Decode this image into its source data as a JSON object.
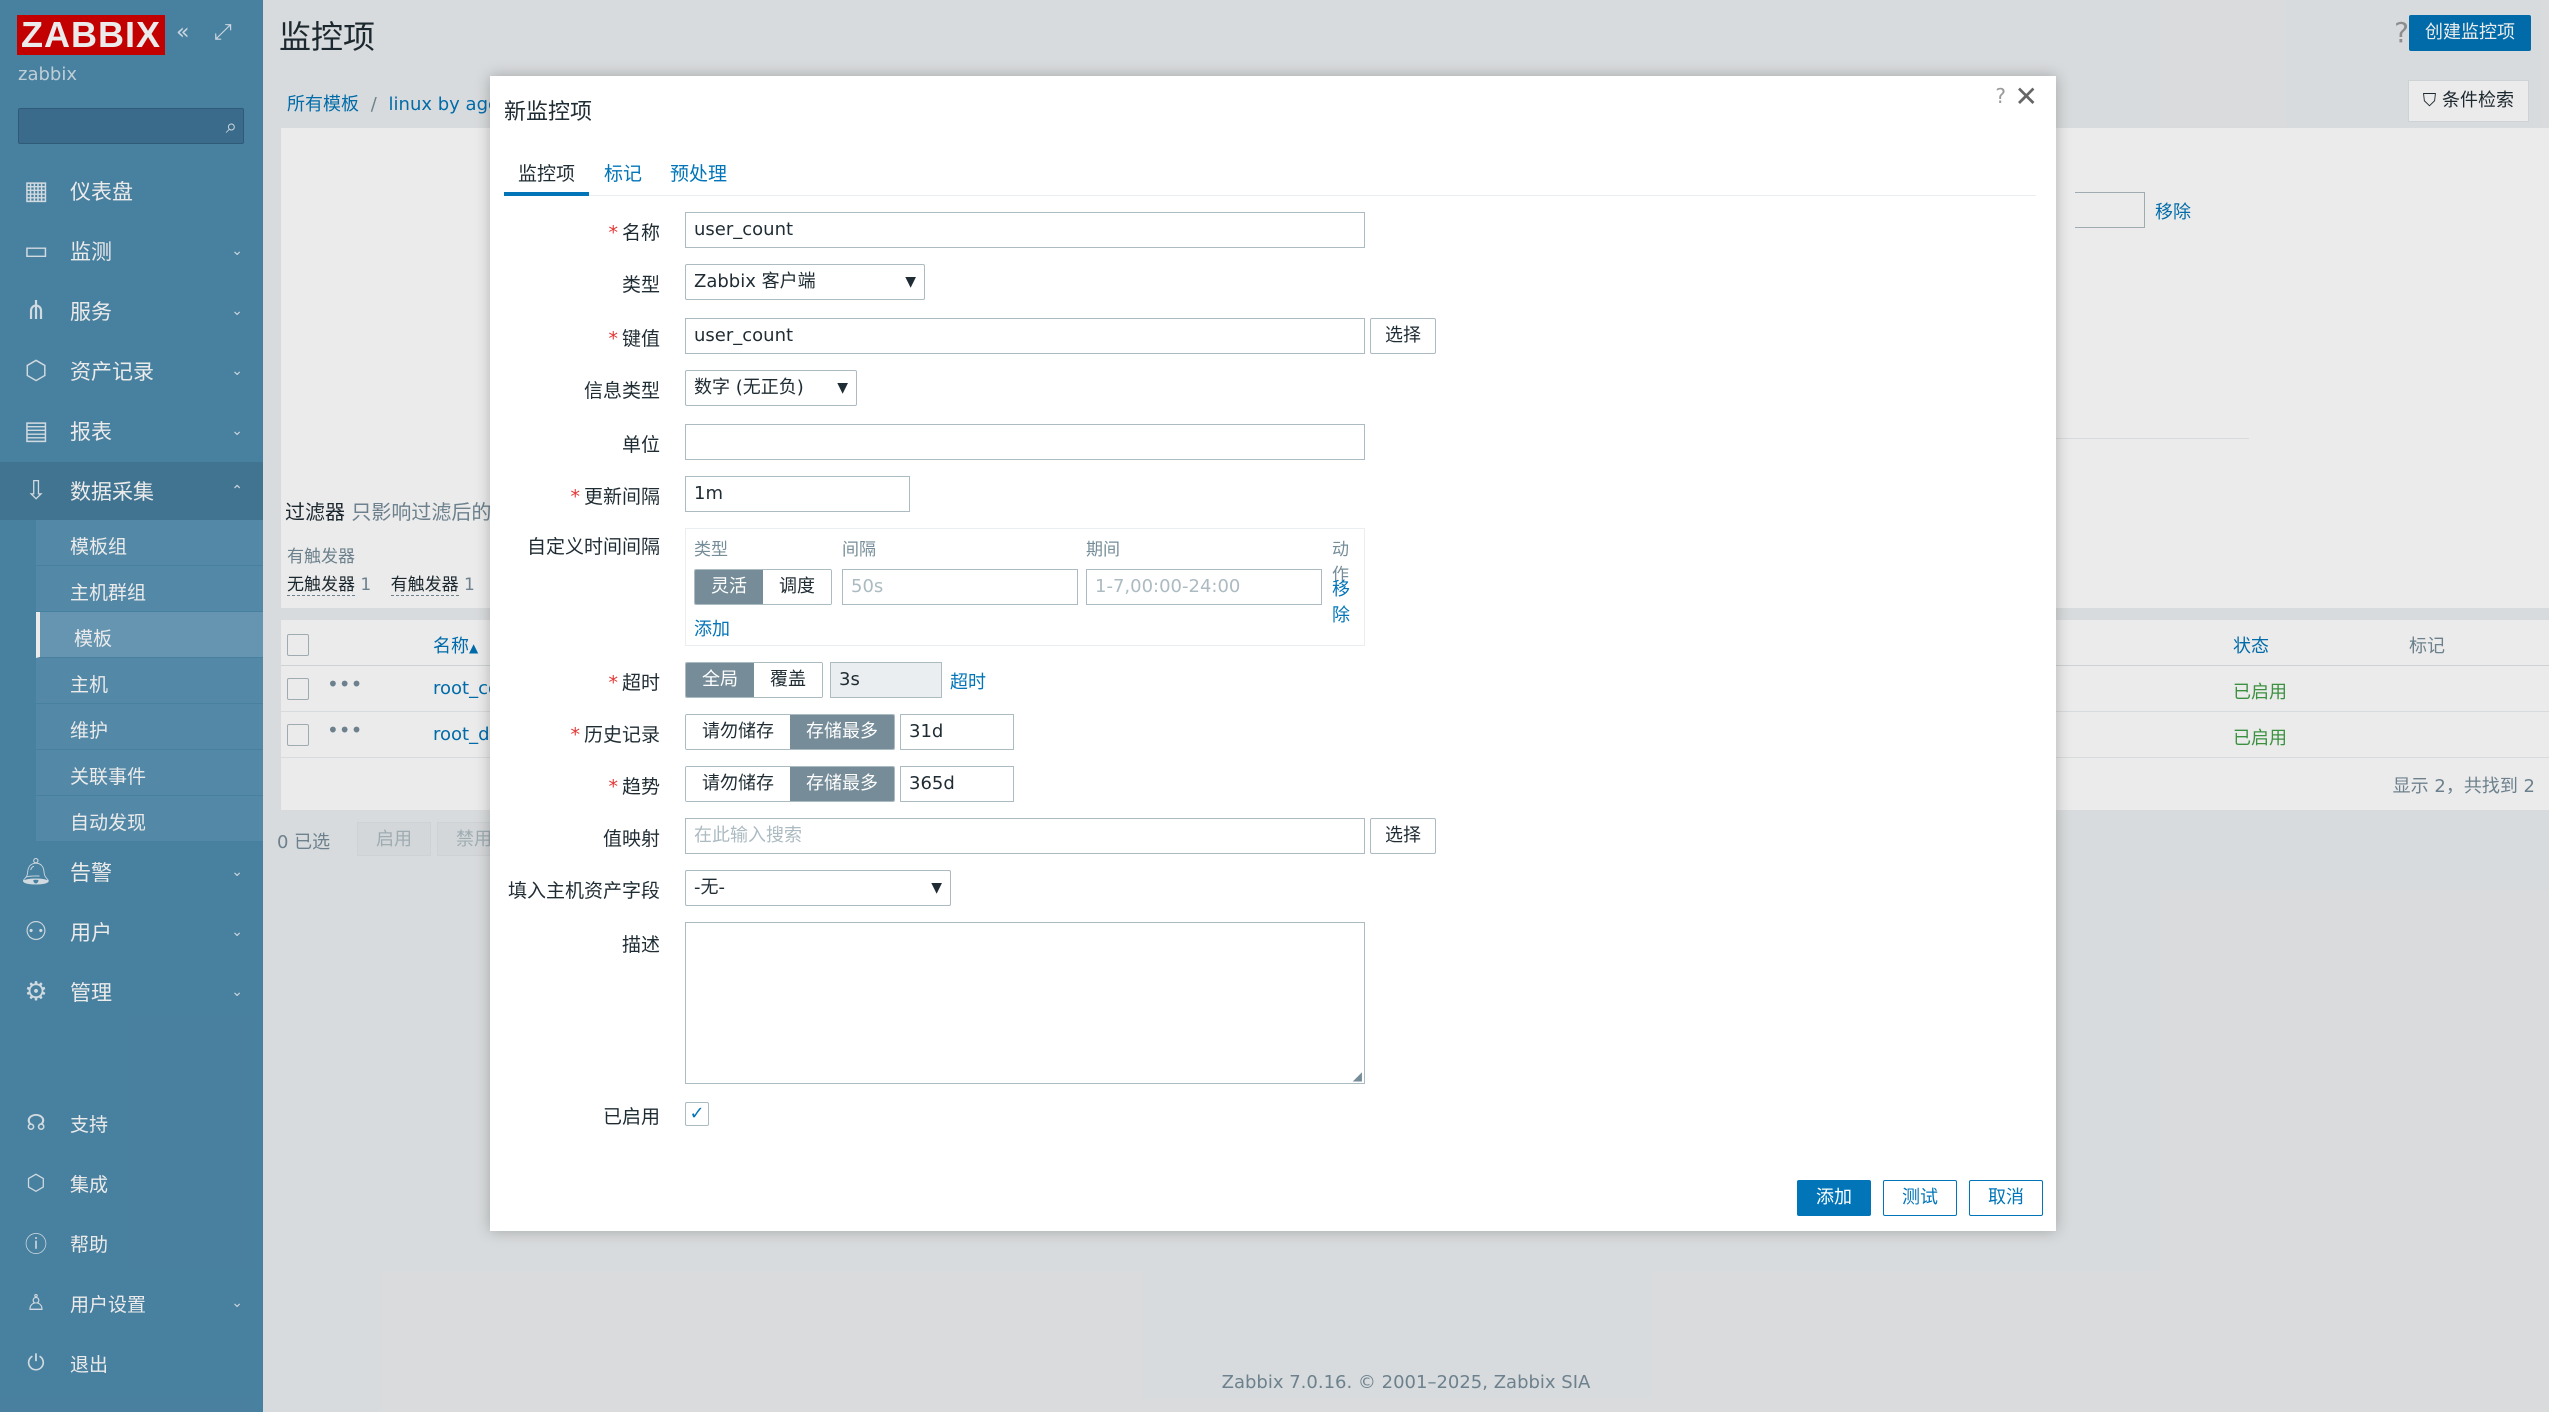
{
  "sidebar": {
    "logo": "ZABBIX",
    "server": "zabbix",
    "search_placeholder": "",
    "menu": [
      {
        "label": "仪表盘",
        "icon": "dashboard-icon"
      },
      {
        "label": "监测",
        "icon": "monitoring-icon"
      },
      {
        "label": "服务",
        "icon": "services-icon"
      },
      {
        "label": "资产记录",
        "icon": "inventory-icon"
      },
      {
        "label": "报表",
        "icon": "reports-icon"
      },
      {
        "label": "数据采集",
        "icon": "data-collection-icon"
      }
    ],
    "submenu": [
      "模板组",
      "主机群组",
      "模板",
      "主机",
      "维护",
      "关联事件",
      "自动发现"
    ],
    "menu2": [
      {
        "label": "告警",
        "icon": "alerts-icon"
      },
      {
        "label": "用户",
        "icon": "users-icon"
      },
      {
        "label": "管理",
        "icon": "administration-icon"
      }
    ],
    "bottom": [
      {
        "label": "支持",
        "icon": "support-icon"
      },
      {
        "label": "集成",
        "icon": "integrations-icon"
      },
      {
        "label": "帮助",
        "icon": "help-icon"
      },
      {
        "label": "用户设置",
        "icon": "user-settings-icon"
      },
      {
        "label": "退出",
        "icon": "signout-icon"
      }
    ]
  },
  "header": {
    "title": "监控项",
    "help": "?",
    "create_button": "创建监控项"
  },
  "breadcrumb": {
    "root": "所有模板",
    "sep": "/",
    "template": "linux by agen"
  },
  "filter": {
    "button": "条件检索",
    "remove": "移除",
    "title": "过滤器",
    "hint": "只影响过滤后的",
    "triggers_label": "有触发器",
    "no_triggers": "无触发器",
    "no_triggers_count": "1",
    "has_triggers": "有触发器",
    "has_triggers_count": "1"
  },
  "table": {
    "col_name": "名称",
    "col_status": "状态",
    "col_tags": "标记",
    "rows": [
      {
        "name": "root_co",
        "status": "已启用"
      },
      {
        "name": "root_di",
        "status": "已启用"
      }
    ],
    "summary": "显示 2，共找到 2",
    "selected": "0 已选",
    "enable": "启用",
    "disable": "禁用"
  },
  "modal": {
    "title": "新监控项",
    "help": "?",
    "close": "✕",
    "tabs": [
      "监控项",
      "标记",
      "预处理"
    ],
    "fields": {
      "name_label": "名称",
      "name_value": "user_count",
      "type_label": "类型",
      "type_value": "Zabbix 客户端",
      "key_label": "键值",
      "key_value": "user_count",
      "select": "选择",
      "info_type_label": "信息类型",
      "info_type_value": "数字 (无正负)",
      "units_label": "单位",
      "units_value": "",
      "interval_label": "更新间隔",
      "interval_value": "1m",
      "custom_label": "自定义时间间隔",
      "custom_cols": [
        "类型",
        "间隔",
        "期间",
        "动作"
      ],
      "flexible": "灵活",
      "scheduling": "调度",
      "interval_ph": "50s",
      "period_ph": "1-7,00:00-24:00",
      "remove": "移除",
      "add": "添加",
      "timeout_label": "超时",
      "timeout_global": "全局",
      "timeout_override": "覆盖",
      "timeout_value": "3s",
      "timeout_link": "超时",
      "history_label": "历史记录",
      "do_not_store": "请勿储存",
      "store_up_to": "存储最多",
      "history_value": "31d",
      "trends_label": "趋势",
      "trends_value": "365d",
      "valuemap_label": "值映射",
      "valuemap_ph": "在此输入搜索",
      "inventory_label": "填入主机资产字段",
      "inventory_value": "-无-",
      "desc_label": "描述",
      "enabled_label": "已启用"
    },
    "buttons": {
      "add": "添加",
      "test": "测试",
      "cancel": "取消"
    }
  },
  "footer": "Zabbix 7.0.16. © 2001–2025, Zabbix SIA"
}
